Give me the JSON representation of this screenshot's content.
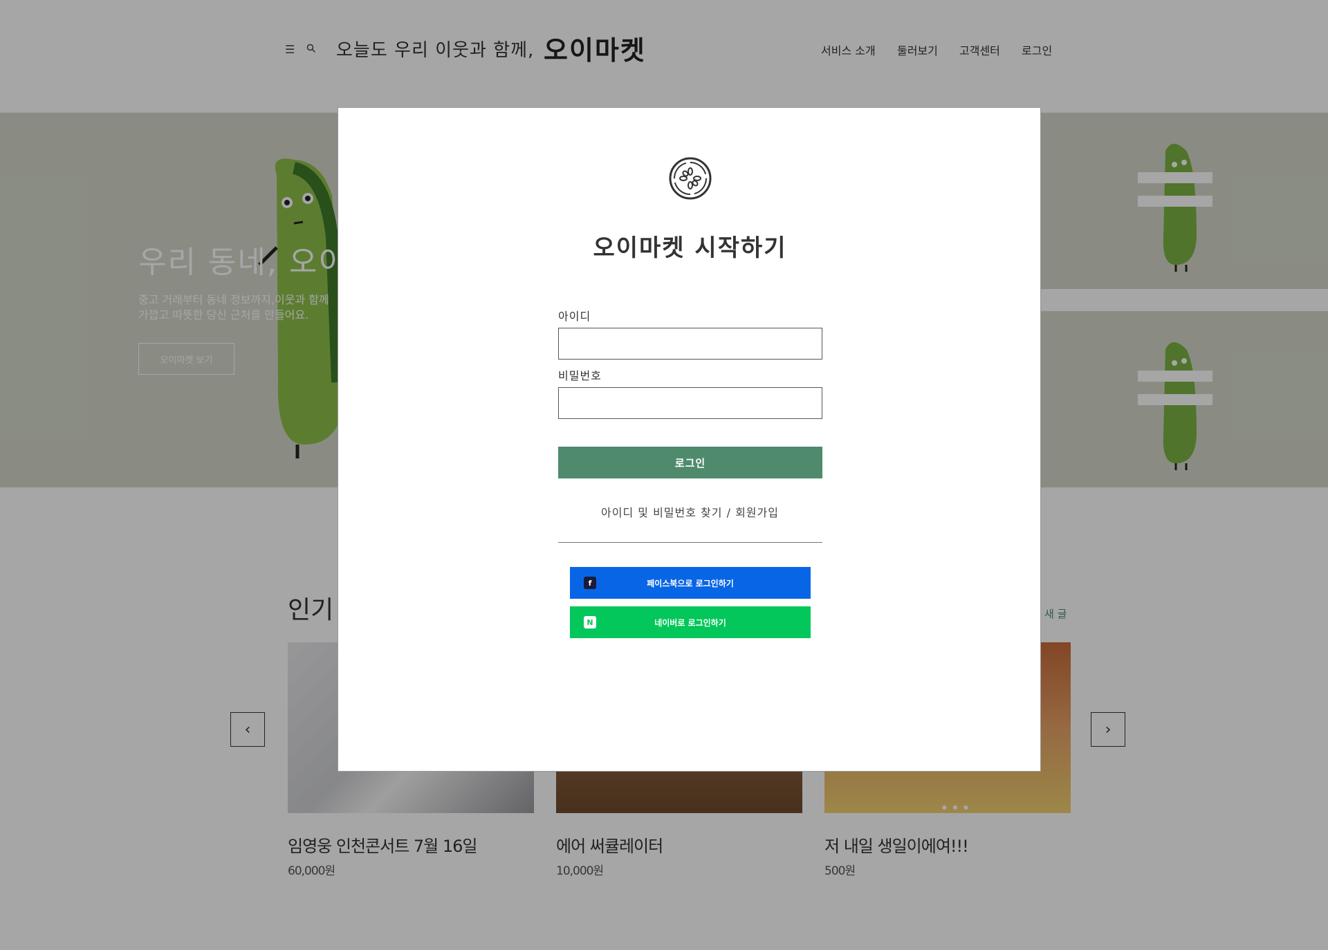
{
  "header": {
    "tagline": "오늘도 우리 이웃과 함께,",
    "brand": "오이마켓",
    "nav": [
      "서비스 소개",
      "둘러보기",
      "고객센터",
      "로그인"
    ]
  },
  "hero": {
    "title": "우리 동네, 오이마켓",
    "desc_line1": "중고 거래부터 동네 정보까지,이웃과 함께",
    "desc_line2": "가깝고 따뜻한 당신 근처를 만들어요.",
    "button": "오이마켓 보기"
  },
  "popular": {
    "title": "인기 매물",
    "new_link": "새 글",
    "cards": [
      {
        "title": "임영웅 인천콘서트 7월 16일",
        "price": "60,000원"
      },
      {
        "title": "에어 써큘레이터",
        "price": "10,000원"
      },
      {
        "title": "저 내일 생일이에여!!!",
        "price": "500원"
      }
    ],
    "prev_arrow": "‹",
    "next_arrow": "›"
  },
  "modal": {
    "title": "오이마켓 시작하기",
    "id_label": "아이디",
    "id_value": "",
    "pw_label": "비밀번호",
    "pw_value": "",
    "login_button": "로그인",
    "find_link": "아이디 및 비밀번호 찾기",
    "separator": "/",
    "signup_link": "회원가입",
    "facebook_button": "페이스북으로 로그인하기",
    "naver_button": "네이버로 로그인하기",
    "naver_icon_letter": "N",
    "facebook_icon_letter": "f"
  },
  "colors": {
    "accent_green": "#4f8a6d",
    "facebook_blue": "#0866e6",
    "naver_green": "#03c75a",
    "overlay": "rgba(0,0,0,0.35)"
  },
  "icons": [
    "menu-icon",
    "search-icon",
    "cucumber-logo-icon",
    "facebook-icon",
    "naver-icon",
    "chevron-left-icon",
    "chevron-right-icon"
  ]
}
